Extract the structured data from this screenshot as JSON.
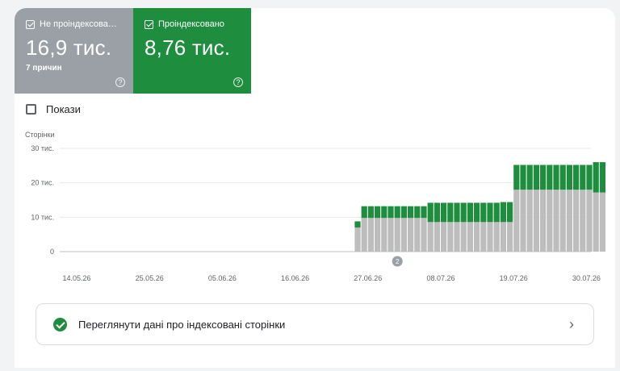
{
  "tiles": [
    {
      "label": "Не проіндексова…",
      "value": "16,9 тис.",
      "sub": "7 причин",
      "help": "?"
    },
    {
      "label": "Проіндексовано",
      "value": "8,76 тис.",
      "sub": "",
      "help": "?"
    }
  ],
  "impressions": {
    "label": "Покази"
  },
  "chart_data": {
    "type": "bar",
    "ylabel": "Сторінки",
    "y_ticks": [
      "0",
      "10 тис.",
      "20 тис.",
      "30 тис."
    ],
    "ylim": [
      0,
      30000
    ],
    "x_ticks": [
      "14.05.26",
      "25.05.26",
      "05.06.26",
      "16.06.26",
      "27.06.26",
      "08.07.26",
      "19.07.26",
      "30.07.26"
    ],
    "start_date": "2026-05-14",
    "series": [
      {
        "name": "Не проіндексовано",
        "color": "#bdbdbd"
      },
      {
        "name": "Проіндексовано",
        "color": "#1e8e3e"
      }
    ],
    "bars": [
      {
        "date": "2026-06-28",
        "not_indexed": 7000,
        "indexed": 1800
      },
      {
        "date": "2026-06-29",
        "not_indexed": 9800,
        "indexed": 3400
      },
      {
        "date": "2026-06-30",
        "not_indexed": 9800,
        "indexed": 3400
      },
      {
        "date": "2026-07-01",
        "not_indexed": 9800,
        "indexed": 3400
      },
      {
        "date": "2026-07-02",
        "not_indexed": 9800,
        "indexed": 3400
      },
      {
        "date": "2026-07-03",
        "not_indexed": 9800,
        "indexed": 3400
      },
      {
        "date": "2026-07-04",
        "not_indexed": 9800,
        "indexed": 3400
      },
      {
        "date": "2026-07-05",
        "not_indexed": 9800,
        "indexed": 3400
      },
      {
        "date": "2026-07-06",
        "not_indexed": 9800,
        "indexed": 3400
      },
      {
        "date": "2026-07-07",
        "not_indexed": 9800,
        "indexed": 3400
      },
      {
        "date": "2026-07-08",
        "not_indexed": 9800,
        "indexed": 3400
      },
      {
        "date": "2026-07-09",
        "not_indexed": 8600,
        "indexed": 5600
      },
      {
        "date": "2026-07-10",
        "not_indexed": 8600,
        "indexed": 5600
      },
      {
        "date": "2026-07-11",
        "not_indexed": 8600,
        "indexed": 5600
      },
      {
        "date": "2026-07-12",
        "not_indexed": 8600,
        "indexed": 5600
      },
      {
        "date": "2026-07-13",
        "not_indexed": 8600,
        "indexed": 5600
      },
      {
        "date": "2026-07-14",
        "not_indexed": 8600,
        "indexed": 5600
      },
      {
        "date": "2026-07-15",
        "not_indexed": 8600,
        "indexed": 5600
      },
      {
        "date": "2026-07-16",
        "not_indexed": 8600,
        "indexed": 5600
      },
      {
        "date": "2026-07-17",
        "not_indexed": 8600,
        "indexed": 5600
      },
      {
        "date": "2026-07-18",
        "not_indexed": 8600,
        "indexed": 5600
      },
      {
        "date": "2026-07-19",
        "not_indexed": 8600,
        "indexed": 5600
      },
      {
        "date": "2026-07-20",
        "not_indexed": 8600,
        "indexed": 5800
      },
      {
        "date": "2026-07-21",
        "not_indexed": 8600,
        "indexed": 5800
      },
      {
        "date": "2026-07-22",
        "not_indexed": 18000,
        "indexed": 7200
      },
      {
        "date": "2026-07-23",
        "not_indexed": 18000,
        "indexed": 7200
      },
      {
        "date": "2026-07-24",
        "not_indexed": 18000,
        "indexed": 7200
      },
      {
        "date": "2026-07-25",
        "not_indexed": 18000,
        "indexed": 7200
      },
      {
        "date": "2026-07-26",
        "not_indexed": 18000,
        "indexed": 7200
      },
      {
        "date": "2026-07-27",
        "not_indexed": 18000,
        "indexed": 7200
      },
      {
        "date": "2026-07-28",
        "not_indexed": 18000,
        "indexed": 7200
      },
      {
        "date": "2026-07-29",
        "not_indexed": 18000,
        "indexed": 7200
      },
      {
        "date": "2026-07-30",
        "not_indexed": 18000,
        "indexed": 7200
      },
      {
        "date": "2026-07-31",
        "not_indexed": 18000,
        "indexed": 7200
      },
      {
        "date": "2026-08-01",
        "not_indexed": 18000,
        "indexed": 7200
      },
      {
        "date": "2026-08-02",
        "not_indexed": 18000,
        "indexed": 7200
      },
      {
        "date": "2026-08-03",
        "not_indexed": 17200,
        "indexed": 8800
      },
      {
        "date": "2026-08-04",
        "not_indexed": 17200,
        "indexed": 8800
      }
    ],
    "annotation": {
      "date": "2026-07-04",
      "label": "2"
    }
  },
  "link_card": {
    "text": "Переглянути дані про індексовані сторінки",
    "chevron": "›"
  }
}
